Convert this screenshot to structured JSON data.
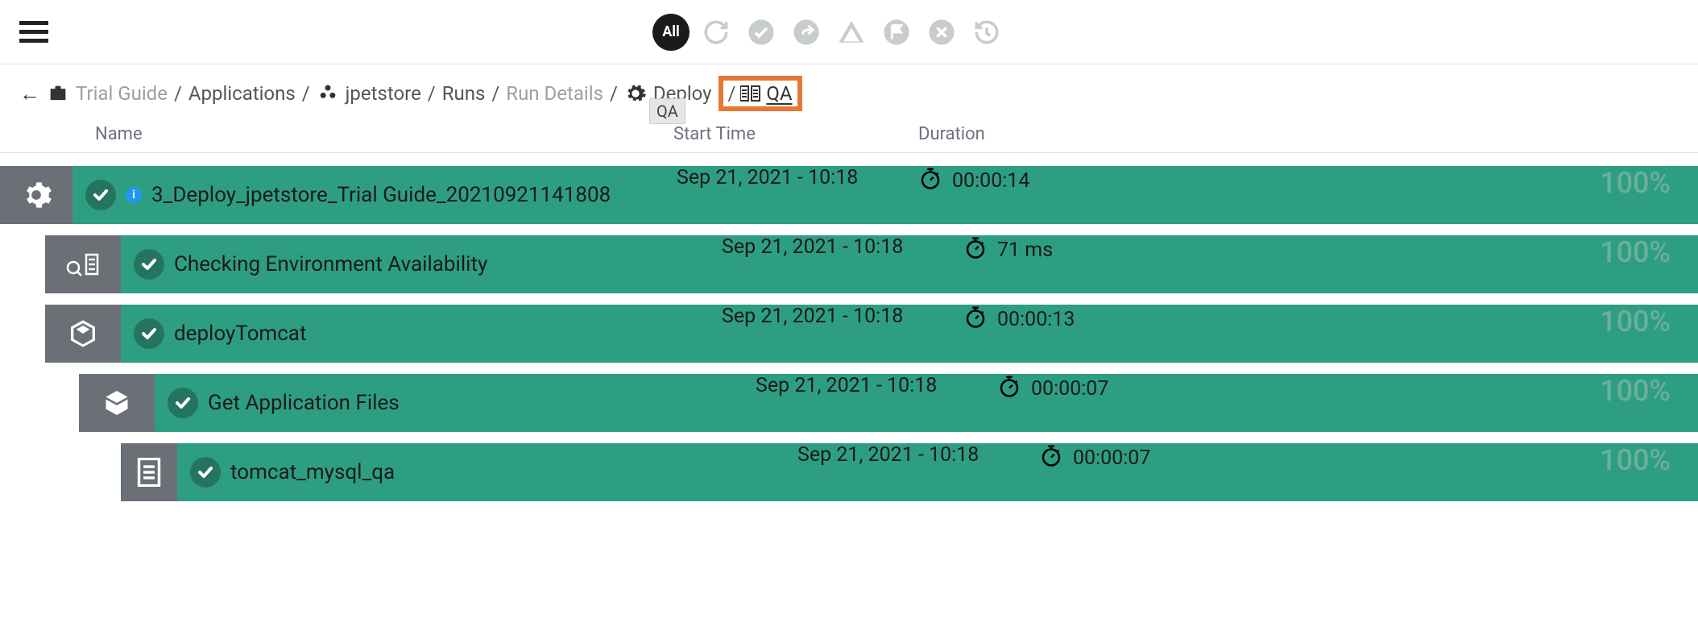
{
  "toolbar": {
    "all_label": "All"
  },
  "breadcrumb": {
    "items": [
      {
        "label": "Trial Guide",
        "light": true
      },
      {
        "label": "Applications",
        "light": false
      },
      {
        "label": "jpetstore",
        "light": false
      },
      {
        "label": "Runs",
        "light": false
      },
      {
        "label": "Run Details",
        "light": true
      },
      {
        "label": "Deploy",
        "light": false
      }
    ],
    "qa_label": "QA",
    "qa_tooltip": "QA"
  },
  "headers": {
    "name": "Name",
    "start": "Start Time",
    "duration": "Duration"
  },
  "rows": [
    {
      "level": 0,
      "icon": "gear",
      "show_info": true,
      "name": "3_Deploy_jpetstore_Trial Guide_20210921141808",
      "start": "Sep 21, 2021 - 10:18",
      "duration": "00:00:14",
      "percent": "100%"
    },
    {
      "level": 1,
      "icon": "env",
      "show_info": false,
      "name": "Checking Environment Availability",
      "start": "Sep 21, 2021 - 10:18",
      "duration": "71 ms",
      "percent": "100%"
    },
    {
      "level": 1,
      "icon": "cube",
      "show_info": false,
      "name": "deployTomcat",
      "start": "Sep 21, 2021 - 10:18",
      "duration": "00:00:13",
      "percent": "100%"
    },
    {
      "level": 2,
      "icon": "box",
      "show_info": false,
      "name": "Get Application Files",
      "start": "Sep 21, 2021 - 10:18",
      "duration": "00:00:07",
      "percent": "100%"
    },
    {
      "level": 3,
      "icon": "doc",
      "show_info": false,
      "name": "tomcat_mysql_qa",
      "start": "Sep 21, 2021 - 10:18",
      "duration": "00:00:07",
      "percent": "100%"
    }
  ]
}
